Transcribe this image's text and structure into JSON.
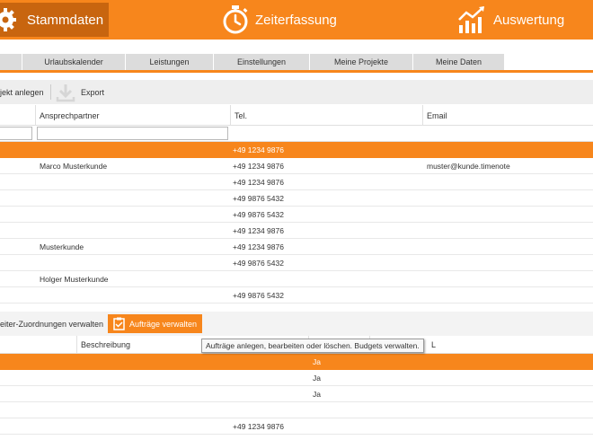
{
  "nav": {
    "stammdaten": "Stammdaten",
    "zeiterfassung": "Zeiterfassung",
    "auswertung": "Auswertung"
  },
  "subtabs": [
    "Urlaubskalender",
    "Leistungen",
    "Einstellungen",
    "Meine Projekte",
    "Meine Daten"
  ],
  "toolbar": {
    "projekt_anlegen": "jekt anlegen",
    "export": "Export"
  },
  "table1": {
    "headers": {
      "ansprechpartner": "Ansprechpartner",
      "tel": "Tel.",
      "email": "Email"
    },
    "rows": [
      {
        "ansprechpartner": "",
        "tel": "+49 1234 9876",
        "email": ""
      },
      {
        "ansprechpartner": "Marco Musterkunde",
        "tel": "+49 1234 9876",
        "email": "muster@kunde.timenote"
      },
      {
        "ansprechpartner": "",
        "tel": "+49 1234 9876",
        "email": ""
      },
      {
        "ansprechpartner": "",
        "tel": "+49 9876 5432",
        "email": ""
      },
      {
        "ansprechpartner": "",
        "tel": "+49 9876 5432",
        "email": ""
      },
      {
        "ansprechpartner": "",
        "tel": "+49 1234 9876",
        "email": ""
      },
      {
        "ansprechpartner": "Musterkunde",
        "tel": "+49 1234 9876",
        "email": ""
      },
      {
        "ansprechpartner": "",
        "tel": "+49 9876 5432",
        "email": ""
      },
      {
        "ansprechpartner": "Holger Musterkunde",
        "tel": "",
        "email": ""
      },
      {
        "ansprechpartner": "",
        "tel": "+49 9876 5432",
        "email": ""
      }
    ]
  },
  "section2": {
    "zuordnungen": "eiter-Zuordnungen verwalten",
    "auftraege": "Aufträge verwalten",
    "headers": {
      "beschreibung": "Beschreibung",
      "last": "L"
    },
    "tooltip": "Aufträge anlegen, bearbeiten oder löschen. Budgets verwalten.",
    "rows": [
      {
        "ja": "Ja",
        "tel": ""
      },
      {
        "ja": "Ja",
        "tel": ""
      },
      {
        "ja": "Ja",
        "tel": ""
      },
      {
        "ja": "",
        "tel": ""
      },
      {
        "ja": "",
        "tel": "+49 1234 9876"
      }
    ]
  },
  "colors": {
    "accent": "#f7861c",
    "accent_dark": "#c8650f"
  }
}
